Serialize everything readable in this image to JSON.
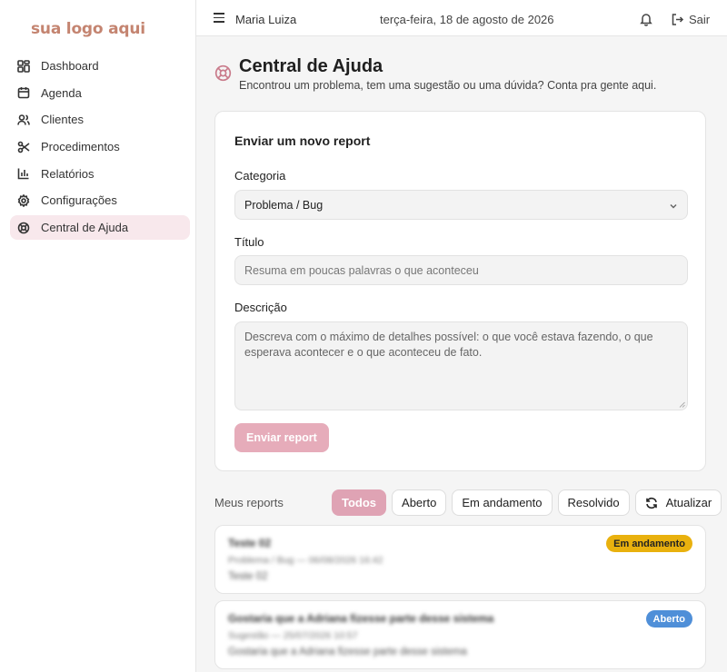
{
  "sidebar": {
    "logo": "sua logo aqui",
    "items": [
      {
        "label": "Dashboard",
        "icon": "grid-icon"
      },
      {
        "label": "Agenda",
        "icon": "calendar-icon"
      },
      {
        "label": "Clientes",
        "icon": "users-icon"
      },
      {
        "label": "Procedimentos",
        "icon": "scissors-icon"
      },
      {
        "label": "Relatórios",
        "icon": "bar-chart-icon"
      },
      {
        "label": "Configurações",
        "icon": "gear-icon"
      },
      {
        "label": "Central de Ajuda",
        "icon": "lifebuoy-icon",
        "active": true
      }
    ]
  },
  "topbar": {
    "user": "Maria Luiza",
    "date": "terça-feira, 18 de agosto de 2026",
    "logout_label": "Sair"
  },
  "page": {
    "title": "Central de Ajuda",
    "subtitle": "Encontrou um problema, tem uma sugestão ou uma dúvida? Conta pra gente aqui."
  },
  "form": {
    "title": "Enviar um novo report",
    "category_label": "Categoria",
    "category_value": "Problema / Bug",
    "title_label": "Título",
    "title_placeholder": "Resuma em poucas palavras o que aconteceu",
    "description_label": "Descrição",
    "description_placeholder": "Descreva com o máximo de detalhes possível: o que você estava fazendo, o que esperava acontecer e o que aconteceu de fato.",
    "submit_label": "Enviar report"
  },
  "reports": {
    "label": "Meus reports",
    "filters": [
      "Todos",
      "Aberto",
      "Em andamento",
      "Resolvido"
    ],
    "active_filter": "Todos",
    "refresh_label": "Atualizar",
    "items": [
      {
        "title": "Teste 02",
        "meta": "Problema / Bug — 06/08/2026 16:42",
        "description": "Teste 02",
        "status": "Em andamento"
      },
      {
        "title": "Gostaria que a Adriana fizesse parte desse sistema",
        "meta": "Sugestão — 25/07/2026 10:57",
        "description": "Gostaria que a Adriana fizesse parte desse sistema",
        "status": "Aberto"
      }
    ]
  },
  "colors": {
    "accent": "#dfa3b4",
    "logo": "#c48470",
    "badge_progress": "#e9b10e",
    "badge_open": "#4f8fd8"
  }
}
